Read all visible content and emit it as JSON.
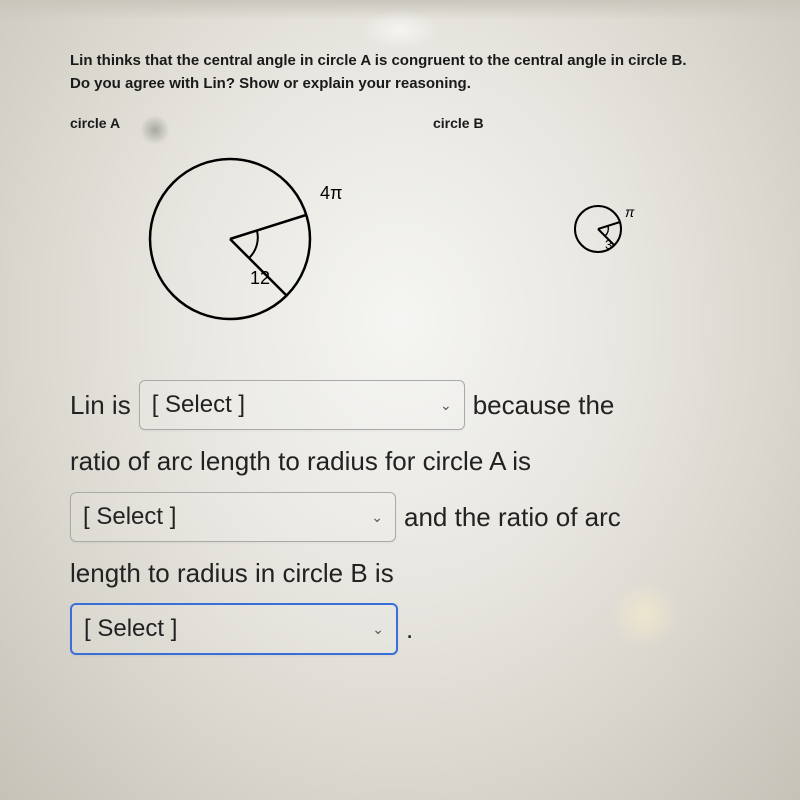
{
  "question": {
    "line1": "Lin thinks that the central angle in circle A is congruent to the central angle in circle B.",
    "line2": "Do you agree with Lin? Show or explain your reasoning."
  },
  "circleA": {
    "label": "circle A",
    "radius_label": "12",
    "arc_label": "4π"
  },
  "circleB": {
    "label": "circle B",
    "radius_label": "3",
    "arc_label": "π"
  },
  "answer": {
    "prefix1": "Lin is",
    "select_placeholder": "[ Select ]",
    "mid1": "because the",
    "line2": "ratio of arc length to radius for circle A is",
    "mid2": "and the ratio of arc",
    "line3": "length to radius in circle B is",
    "period": "."
  }
}
